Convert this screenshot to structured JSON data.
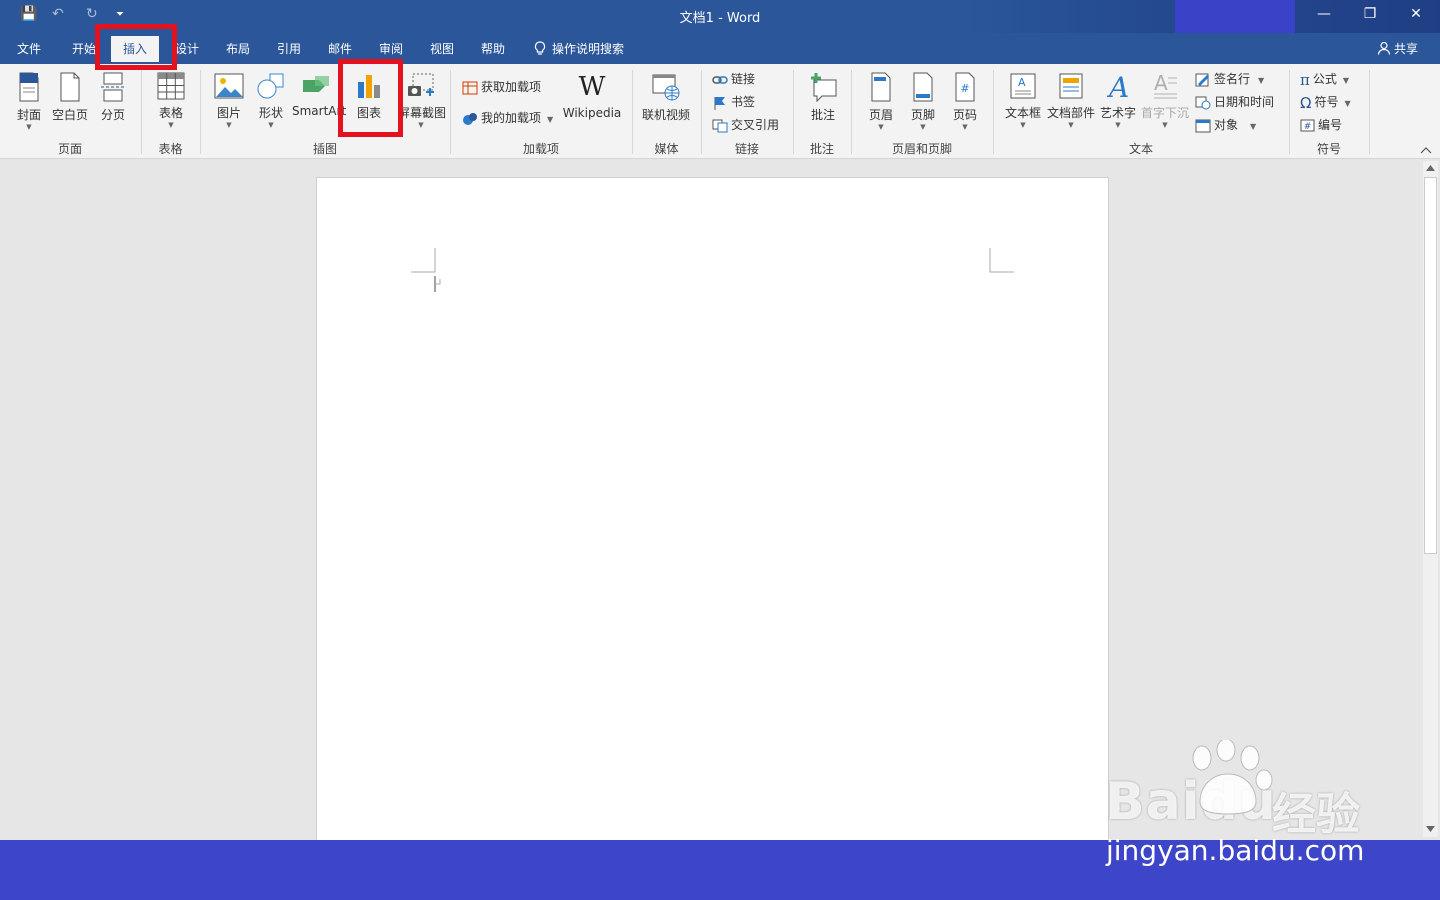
{
  "window": {
    "title": "文档1 - Word"
  },
  "quick_access": {
    "save": "💾",
    "undo": "↶",
    "redo": "↻",
    "customize": "⏷"
  },
  "window_controls": {
    "minimize": "—",
    "restore": "❐",
    "close": "✕"
  },
  "tabs": [
    {
      "label": "文件"
    },
    {
      "label": "开始"
    },
    {
      "label": "插入"
    },
    {
      "label": "设计"
    },
    {
      "label": "布局"
    },
    {
      "label": "引用"
    },
    {
      "label": "邮件"
    },
    {
      "label": "审阅"
    },
    {
      "label": "视图"
    },
    {
      "label": "帮助"
    }
  ],
  "active_tab": "插入",
  "tell_me": "操作说明搜索",
  "share": "共享",
  "ribbon": {
    "cover": "封面",
    "blank": "空白页",
    "pagebreak": "分页",
    "table": "表格",
    "picture": "图片",
    "shape": "形状",
    "smartart": "SmartArt",
    "chart": "图表",
    "screenshot": "屏幕截图",
    "get_addins": "获取加载项",
    "my_addins": "我的加载项",
    "wikipedia": "Wikipedia",
    "wiki_glyph": "W",
    "online_video": "联机视频",
    "link": "链接",
    "bookmark": "书签",
    "crossref": "交叉引用",
    "comment": "批注",
    "header": "页眉",
    "footer": "页脚",
    "pagenum": "页码",
    "textbox": "文本框",
    "quickparts": "文档部件",
    "wordart": "艺术字",
    "dropcap": "首字下沉",
    "signature": "签名行",
    "datetime": "日期和时间",
    "object": "对象",
    "equation": "公式",
    "symbol": "符号",
    "number": "编号",
    "pi": "π",
    "omega": "Ω",
    "hash": "#"
  },
  "groups": {
    "pages": "页面",
    "tables": "表格",
    "illustrations": "插图",
    "addins": "加载项",
    "media": "媒体",
    "links": "链接",
    "comments": "批注",
    "headerfooter": "页眉和页脚",
    "text": "文本",
    "symbols": "符号"
  },
  "watermark": {
    "brand": "Baidu",
    "cn": "经验",
    "url": "jingyan.baidu.com"
  },
  "colors": {
    "accent": "#2b579a",
    "highlight": "#e3121e",
    "footer": "#3d46c8"
  }
}
